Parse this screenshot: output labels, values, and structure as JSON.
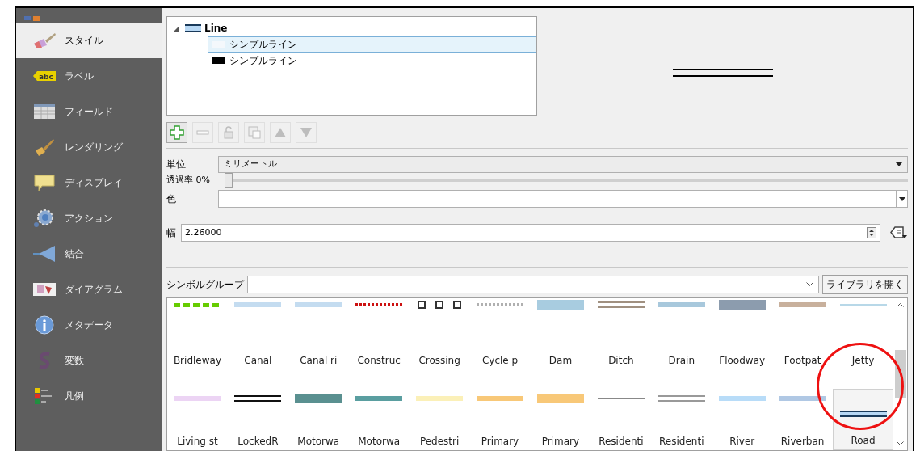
{
  "sidebar": {
    "items": [
      {
        "label": "スタイル",
        "kind": "brush",
        "selected": true
      },
      {
        "label": "ラベル",
        "kind": "abc",
        "selected": false
      },
      {
        "label": "フィールド",
        "kind": "table",
        "selected": false
      },
      {
        "label": "レンダリング",
        "kind": "paintbrush",
        "selected": false
      },
      {
        "label": "ディスプレイ",
        "kind": "speech",
        "selected": false
      },
      {
        "label": "アクション",
        "kind": "gear",
        "selected": false
      },
      {
        "label": "結合",
        "kind": "join",
        "selected": false
      },
      {
        "label": "ダイアグラム",
        "kind": "diagram",
        "selected": false
      },
      {
        "label": "メタデータ",
        "kind": "info",
        "selected": false
      },
      {
        "label": "変数",
        "kind": "variable",
        "selected": false
      },
      {
        "label": "凡例",
        "kind": "legend",
        "selected": false
      }
    ]
  },
  "symbol_tree": {
    "label": "Line",
    "expanded": true,
    "children": [
      {
        "label": "シンプルライン",
        "color": "#f4f8fc",
        "selected": true
      },
      {
        "label": "シンプルライン",
        "color": "#000000",
        "selected": false
      }
    ]
  },
  "layer_toolbar": [
    {
      "kind": "add",
      "disabled": false
    },
    {
      "kind": "remove",
      "disabled": true
    },
    {
      "kind": "lock",
      "disabled": true
    },
    {
      "kind": "duplicate",
      "disabled": true
    },
    {
      "kind": "up",
      "disabled": true
    },
    {
      "kind": "down",
      "disabled": true
    }
  ],
  "form": {
    "unit_label": "単位",
    "unit_value": "ミリメートル",
    "opacity_label": "透過率 0%",
    "opacity": {
      "level": 0
    },
    "color_label": "色",
    "width_label": "幅",
    "width_value": "2.26000"
  },
  "symbol_group": {
    "label": "シンボルグループ",
    "button": "ライブラリを開く"
  },
  "symbols": [
    {
      "name": "Bridleway",
      "kind": "dashed",
      "color": "#66cc00",
      "selected": false
    },
    {
      "name": "Canal",
      "kind": "solid",
      "color": "#c4dcf0",
      "selected": false
    },
    {
      "name": "Canal ri",
      "kind": "solid",
      "color": "#c4dcf0",
      "selected": false
    },
    {
      "name": "Construc",
      "kind": "dotted",
      "color": "#cc1111",
      "selected": false
    },
    {
      "name": "Crossing",
      "kind": "boxes",
      "color": "#333333",
      "selected": false
    },
    {
      "name": "Cycle p",
      "kind": "dotted",
      "color": "#b0b0b0",
      "selected": false
    },
    {
      "name": "Dam",
      "kind": "thick",
      "color": "#a8cce0",
      "selected": false
    },
    {
      "name": "Ditch",
      "kind": "double",
      "color": "#a09080",
      "selected": false
    },
    {
      "name": "Drain",
      "kind": "solid",
      "color": "#a8c8dc",
      "selected": false
    },
    {
      "name": "Floodway",
      "kind": "thick",
      "color": "#8c9cae",
      "selected": false
    },
    {
      "name": "Footpat",
      "kind": "solid",
      "color": "#c8b09c",
      "selected": false
    },
    {
      "name": "Jetty",
      "kind": "thin",
      "color": "#b8d8e8",
      "selected": false
    },
    {
      "name": "Living st",
      "kind": "solid",
      "color": "#ecd4f4",
      "selected": false
    },
    {
      "name": "LockedR",
      "kind": "double",
      "color": "#111111",
      "selected": false
    },
    {
      "name": "Motorwa",
      "kind": "thick",
      "color": "#5a9090",
      "selected": false
    },
    {
      "name": "Motorwa",
      "kind": "solid",
      "color": "#5a9ea0",
      "selected": false
    },
    {
      "name": "Pedestri",
      "kind": "solid",
      "color": "#fbf0b8",
      "selected": false
    },
    {
      "name": "Primary",
      "kind": "solid",
      "color": "#f8c878",
      "selected": false
    },
    {
      "name": "Primary",
      "kind": "thick",
      "color": "#f8c878",
      "selected": false
    },
    {
      "name": "Residenti",
      "kind": "thin",
      "color": "#888888",
      "selected": false
    },
    {
      "name": "Residenti",
      "kind": "double",
      "color": "#999999",
      "selected": false
    },
    {
      "name": "River",
      "kind": "solid",
      "color": "#b8dcf8",
      "selected": false
    },
    {
      "name": "Riverban",
      "kind": "solid",
      "color": "#b0c8e4",
      "selected": false
    },
    {
      "name": "Road",
      "kind": "road",
      "color": "#1a3a5a",
      "selected": true
    }
  ]
}
